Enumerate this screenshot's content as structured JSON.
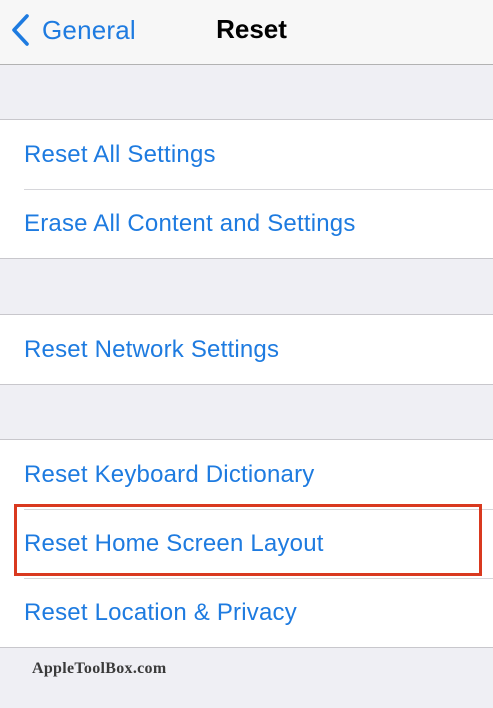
{
  "navbar": {
    "back_label": "General",
    "title": "Reset"
  },
  "groups": [
    {
      "items": [
        {
          "label": "Reset All Settings"
        },
        {
          "label": "Erase All Content and Settings"
        }
      ]
    },
    {
      "items": [
        {
          "label": "Reset Network Settings"
        }
      ]
    },
    {
      "items": [
        {
          "label": "Reset Keyboard Dictionary"
        },
        {
          "label": "Reset Home Screen Layout"
        },
        {
          "label": "Reset Location & Privacy"
        }
      ]
    }
  ],
  "watermark": "AppleToolBox.com",
  "colors": {
    "accent": "#1e7be0",
    "highlight": "#d9391f",
    "background": "#efeff4"
  },
  "icons": {
    "back": "chevron-left-icon"
  }
}
